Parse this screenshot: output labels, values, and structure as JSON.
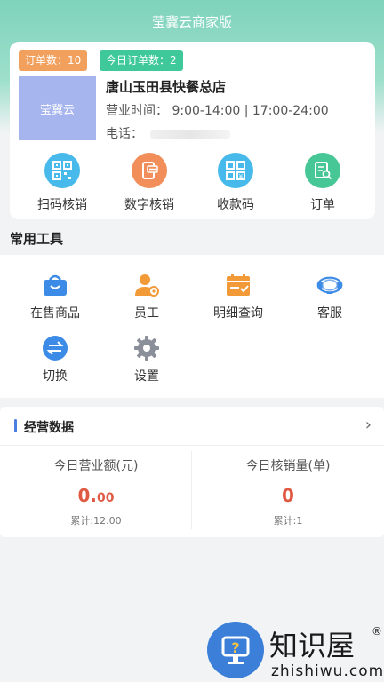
{
  "header": {
    "title": "莹冀云商家版"
  },
  "store": {
    "order_count_badge": "订单数：10",
    "today_order_badge": "今日订单数：2",
    "logo_text": "莹冀云",
    "name": "唐山玉田县快餐总店",
    "hours": "营业时间：  9:00-14:00  |  17:00-24:00",
    "phone_label": "电话："
  },
  "quick_actions": [
    {
      "label": "扫码核销",
      "icon": "qr-scan-icon",
      "color": "#47b9ea"
    },
    {
      "label": "数字核销",
      "icon": "phone-verify-icon",
      "color": "#f28e5a"
    },
    {
      "label": "收款码",
      "icon": "payment-qr-icon",
      "color": "#47b9ea"
    },
    {
      "label": "订单",
      "icon": "order-icon",
      "color": "#47c795"
    }
  ],
  "tools": {
    "title": "常用工具",
    "items": [
      {
        "label": "在售商品",
        "icon": "shopping-bag-icon"
      },
      {
        "label": "员工",
        "icon": "staff-icon"
      },
      {
        "label": "明细查询",
        "icon": "calendar-check-icon"
      },
      {
        "label": "客服",
        "icon": "headset-icon"
      },
      {
        "label": "切换",
        "icon": "switch-icon"
      },
      {
        "label": "设置",
        "icon": "gear-icon"
      }
    ]
  },
  "business": {
    "title": "经营数据",
    "revenue": {
      "label": "今日营业额(元)",
      "value_int": "0.",
      "value_dec": "00",
      "total": "累计:12.00"
    },
    "verified": {
      "label": "今日核销量(单)",
      "value": "0",
      "total": "累计:1"
    }
  },
  "watermark": {
    "cn": "知识屋",
    "en": "zhishiwu.com",
    "reg": "®"
  }
}
